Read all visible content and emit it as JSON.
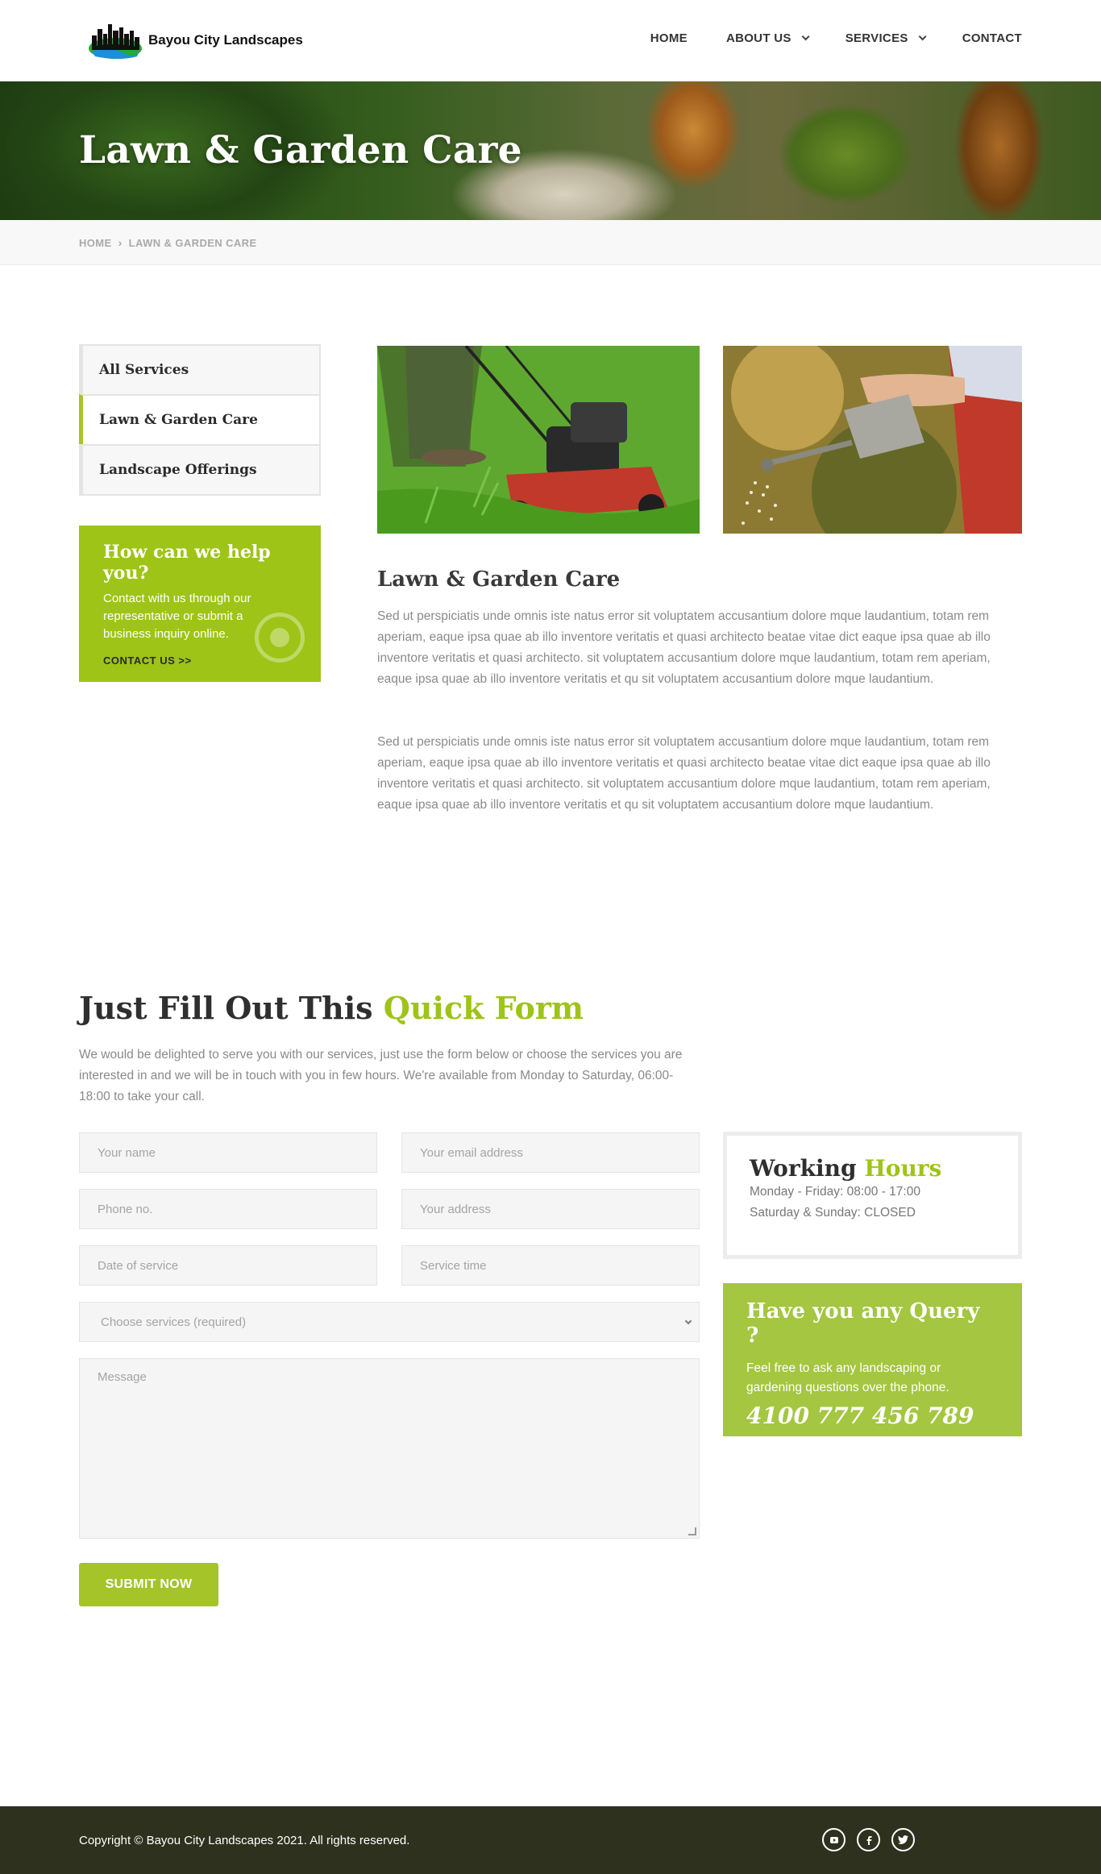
{
  "brand": {
    "name": "Bayou City Landscapes"
  },
  "nav": {
    "home": "HOME",
    "about": "ABOUT US",
    "services": "SERVICES",
    "contact": "CONTACT"
  },
  "hero": {
    "title": "Lawn & Garden Care"
  },
  "breadcrumb": {
    "home": "HOME",
    "separator": "›",
    "current": "LAWN & GARDEN CARE"
  },
  "sidebar": {
    "items": [
      {
        "label": "All Services",
        "active": false
      },
      {
        "label": "Lawn & Garden Care",
        "active": true
      },
      {
        "label": "Landscape Offerings",
        "active": false
      }
    ],
    "help": {
      "title": "How can we help you?",
      "text": "Contact with us through our representative or submit a business inquiry online.",
      "link": "CONTACT US >>",
      "icon": "whatsapp-icon"
    }
  },
  "main": {
    "images": [
      "lawn-mower-image",
      "watering-can-image"
    ],
    "title": "Lawn & Garden Care",
    "paragraphs": [
      "Sed ut perspiciatis unde omnis iste natus error sit voluptatem accusantium dolore mque laudantium, totam rem aperiam, eaque ipsa quae ab illo inventore veritatis et quasi architecto beatae vitae dict eaque ipsa quae ab illo inventore veritatis et quasi architecto. sit voluptatem accusantium dolore mque laudantium, totam rem aperiam, eaque ipsa quae ab illo inventore veritatis et qu sit voluptatem accusantium dolore mque laudantium.",
      "Sed ut perspiciatis unde omnis iste natus error sit voluptatem accusantium dolore mque laudantium, totam rem aperiam, eaque ipsa quae ab illo inventore veritatis et quasi architecto beatae vitae dict eaque ipsa quae ab illo inventore veritatis et quasi architecto. sit voluptatem accusantium dolore mque laudantium, totam rem aperiam, eaque ipsa quae ab illo inventore veritatis et qu sit voluptatem accusantium dolore mque laudantium."
    ]
  },
  "form": {
    "title_plain": "Just Fill Out This ",
    "title_accent": "Quick Form",
    "intro": "We would be delighted to serve you with our services, just use the form below or choose the services you are interested in and we will be in touch with you in few hours. We're available from Monday to Saturday, 06:00-18:00 to take your call.",
    "name_placeholder": "Your name",
    "email_placeholder": "Your email address",
    "phone_placeholder": "Phone no.",
    "address_placeholder": "Your address",
    "date_placeholder": "Date of service",
    "time_placeholder": "Service time",
    "service_select": "Choose services (required)",
    "message_placeholder": "Message",
    "submit_label": "SUBMIT NOW"
  },
  "hours": {
    "title_plain": "Working ",
    "title_accent": "Hours",
    "weekdays": "Monday - Friday: 08:00 - 17:00",
    "weekend": "Saturday & Sunday: CLOSED"
  },
  "query": {
    "title": "Have you any Query ?",
    "text": "Feel free to ask any landscaping or gardening questions over the phone.",
    "phone": "4100 777 456 789"
  },
  "footer": {
    "copyright": "Copyright © Bayou City Landscapes 2021. All rights reserved.",
    "socials": [
      "youtube-icon",
      "facebook-icon",
      "twitter-icon"
    ]
  },
  "colors": {
    "accent": "#9ec417",
    "accent_light": "#a4c640",
    "footer_bg": "#2f311f"
  }
}
